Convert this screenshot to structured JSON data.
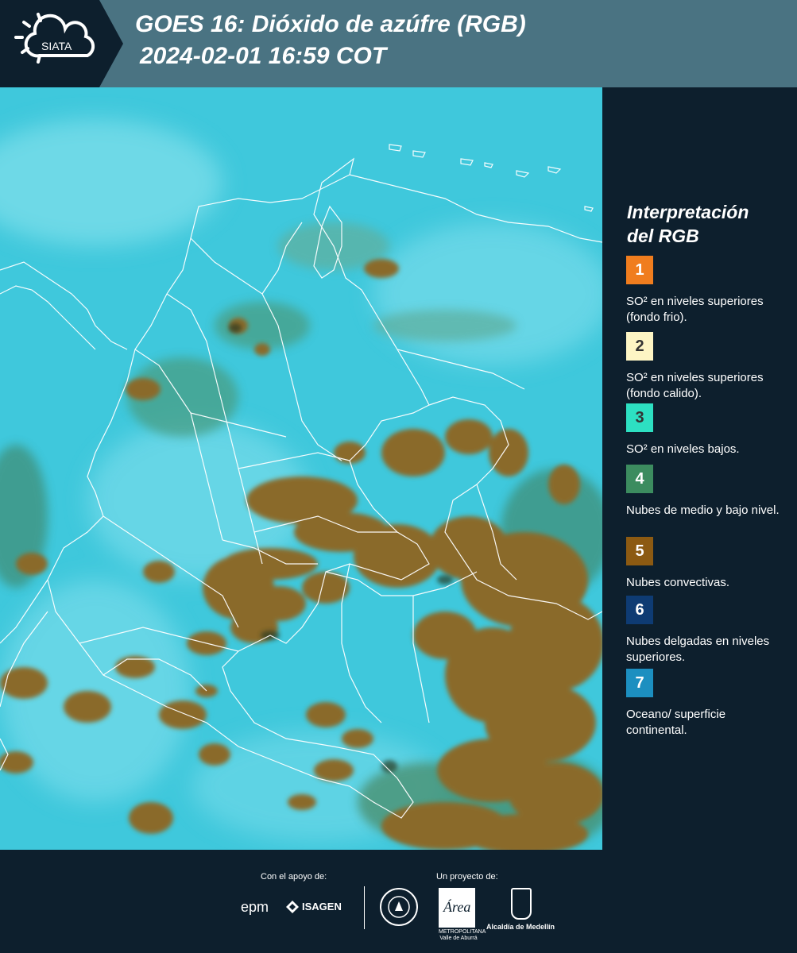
{
  "header": {
    "logo_text": "SIATA",
    "title_line1": "GOES 16: Dióxido de azúfre (RGB)",
    "title_line2": "2024-02-01 16:59 COT",
    "background_color": "#4a7382",
    "logo_panel_color": "#0d1f2d"
  },
  "legend": {
    "title_line1": "Interpretación",
    "title_line2": "del RGB",
    "items": [
      {
        "number": "1",
        "color": "#f07d1e",
        "number_color": "#ffffff",
        "text": "SO² en niveles superiores (fondo frio)."
      },
      {
        "number": "2",
        "color": "#fdf5c4",
        "number_color": "#333333",
        "text": "SO² en niveles superiores (fondo calido)."
      },
      {
        "number": "3",
        "color": "#2de0c2",
        "number_color": "#333333",
        "text": "SO² en niveles bajos."
      },
      {
        "number": "4",
        "color": "#3c8c5f",
        "number_color": "#ffffff",
        "text": "Nubes de medio y bajo nivel."
      },
      {
        "number": "5",
        "color": "#8c5a12",
        "number_color": "#ffffff",
        "text": "Nubes convectivas."
      },
      {
        "number": "6",
        "color": "#0e3b73",
        "number_color": "#ffffff",
        "text": "Nubes delgadas en niveles superiores."
      },
      {
        "number": "7",
        "color": "#1c8fc0",
        "number_color": "#ffffff",
        "text": "Oceano/ superficie continental."
      }
    ]
  },
  "footer": {
    "support_label": "Con el apoyo de:",
    "project_label": "Un proyecto de:",
    "sponsor_1": "epm",
    "sponsor_2": "ISAGEN",
    "area_logo_text": "Área",
    "area_subtext": "METROPOLITANA Valle de Aburrá",
    "alcaldia_text": "Alcaldía de Medellín"
  },
  "map": {
    "background_color": "#3fc8dc",
    "cloud_color": "#8a6a2a",
    "border_color": "#ffffff"
  }
}
